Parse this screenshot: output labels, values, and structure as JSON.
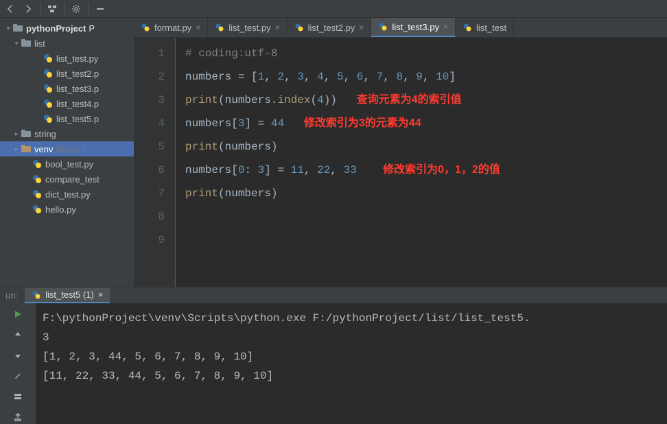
{
  "toolbar": {
    "icons": [
      "back",
      "forward",
      "structure",
      "gear",
      "minimize"
    ]
  },
  "project": {
    "root": {
      "name": "pythonProject",
      "suffix": "P"
    },
    "list_folder": "list",
    "list_files": [
      "list_test.py",
      "list_test2.p",
      "list_test3.p",
      "list_test4.p",
      "list_test5.p"
    ],
    "string_folder": "string",
    "venv_folder": "venv",
    "venv_hint": "library r",
    "root_files": [
      "bool_test.py",
      "compare_test",
      "dict_test.py",
      "hello.py"
    ]
  },
  "tabs": [
    {
      "label": "format.py",
      "active": false
    },
    {
      "label": "list_test.py",
      "active": false
    },
    {
      "label": "list_test2.py",
      "active": false
    },
    {
      "label": "list_test3.py",
      "active": true
    },
    {
      "label": "list_test",
      "active": false,
      "noclose": true
    }
  ],
  "code": {
    "lines": [
      "1",
      "2",
      "3",
      "4",
      "5",
      "6",
      "7",
      "8",
      "9"
    ],
    "a3": "查询元素为4的索引值",
    "a4": "修改索引为3的元素为44",
    "a6": "修改索引为0，1，2的值"
  },
  "run": {
    "panel_label": "un:",
    "tab": "list_test5 (1)",
    "out": [
      "F:\\pythonProject\\venv\\Scripts\\python.exe F:/pythonProject/list/list_test5.",
      "3",
      "[1, 2, 3, 44, 5, 6, 7, 8, 9, 10]",
      "[11, 22, 33, 44, 5, 6, 7, 8, 9, 10]"
    ]
  },
  "chart_data": {
    "type": "code",
    "source": [
      "# coding:utf-8",
      "",
      "numbers = [1, 2, 3, 4, 5, 6, 7, 8, 9, 10]",
      "print(numbers.index(4))",
      "numbers[3] = 44",
      "print(numbers)",
      "numbers[0: 3] = 11, 22, 33",
      "print(numbers)"
    ],
    "annotations": [
      {
        "line": 4,
        "text": "查询元素为4的索引值"
      },
      {
        "line": 5,
        "text": "修改索引为3的元素为44"
      },
      {
        "line": 7,
        "text": "修改索引为0，1，2的值"
      }
    ],
    "stdout": [
      "3",
      "[1, 2, 3, 44, 5, 6, 7, 8, 9, 10]",
      "[11, 22, 33, 44, 5, 6, 7, 8, 9, 10]"
    ]
  }
}
